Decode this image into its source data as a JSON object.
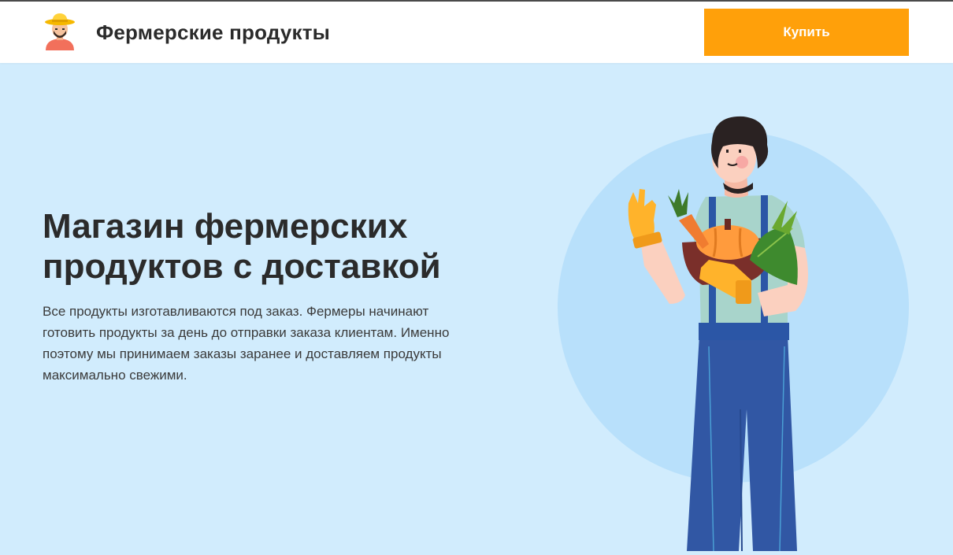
{
  "header": {
    "logo_icon": "farmer-avatar-icon",
    "brand": "Фермерские продукты",
    "buy_label": "Купить",
    "buy_color": "#ffa00a"
  },
  "hero": {
    "title": "Магазин фермерских продуктов с доставкой",
    "description": "Все продукты изготавливаются под заказ. Фермеры начинают готовить продукты за день до отправки заказа клиентам. Именно поэтому мы принимаем заказы заранее и доставляем продукты максимально свежими.",
    "illustration_icon": "farmer-with-vegetables-illustration",
    "background_color": "#d1ecfd",
    "circle_color": "#b8e0fb"
  }
}
